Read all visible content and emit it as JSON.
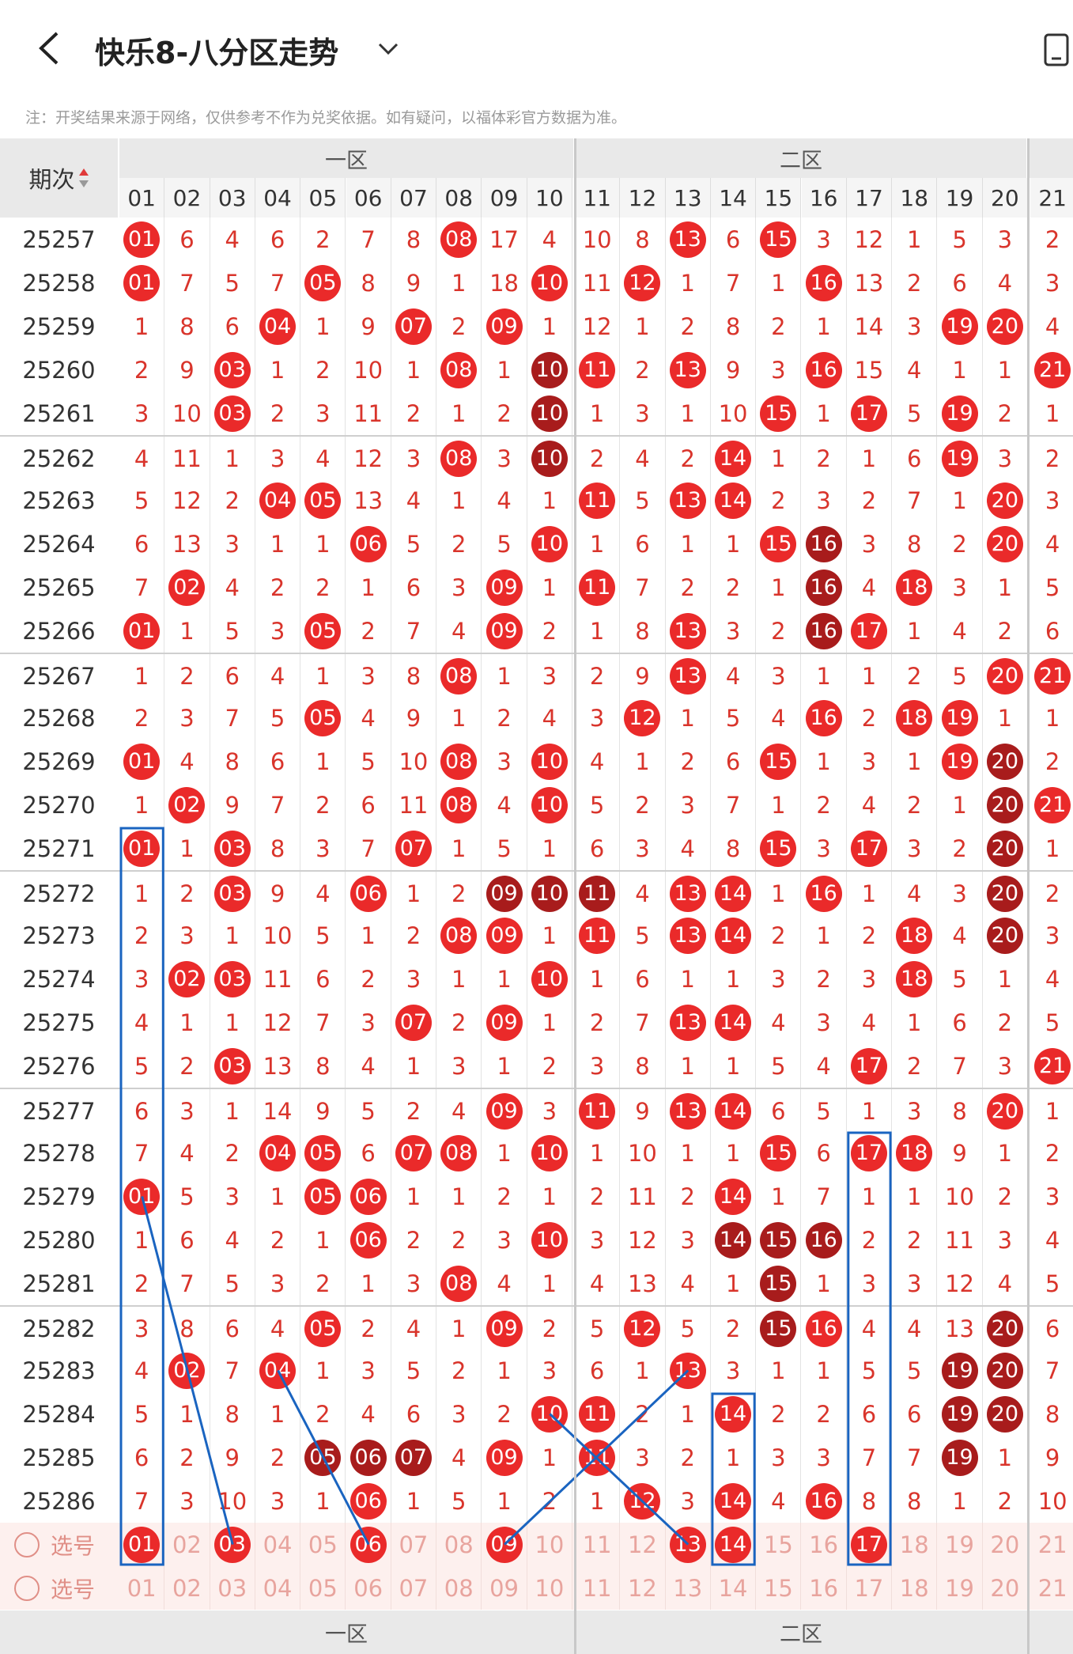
{
  "header": {
    "title": "快乐8-八分区走势",
    "note": "注：开奖结果来源于网络，仅供参考不作为兑奖依据。如有疑问，以福体彩官方数据为准。"
  },
  "table": {
    "period_header": "期次",
    "zones": [
      "一区",
      "二区"
    ],
    "columns": [
      "01",
      "02",
      "03",
      "04",
      "05",
      "06",
      "07",
      "08",
      "09",
      "10",
      "11",
      "12",
      "13",
      "14",
      "15",
      "16",
      "17",
      "18",
      "19",
      "20",
      "21"
    ],
    "rows": [
      {
        "p": "25257",
        "c": [
          "B01",
          "6",
          "4",
          "6",
          "2",
          "7",
          "8",
          "B08",
          "17",
          "4",
          "10",
          "8",
          "B13",
          "6",
          "B15",
          "3",
          "12",
          "1",
          "5",
          "3",
          "2"
        ]
      },
      {
        "p": "25258",
        "c": [
          "B01",
          "7",
          "5",
          "7",
          "B05",
          "8",
          "9",
          "1",
          "18",
          "B10",
          "11",
          "B12",
          "1",
          "7",
          "1",
          "B16",
          "13",
          "2",
          "6",
          "4",
          "3"
        ]
      },
      {
        "p": "25259",
        "c": [
          "1",
          "8",
          "6",
          "B04",
          "1",
          "9",
          "B07",
          "2",
          "B09",
          "1",
          "12",
          "1",
          "2",
          "8",
          "2",
          "1",
          "14",
          "3",
          "B19",
          "B20",
          "4"
        ]
      },
      {
        "p": "25260",
        "c": [
          "2",
          "9",
          "B03",
          "1",
          "2",
          "10",
          "1",
          "B08",
          "1",
          "D10",
          "B11",
          "2",
          "B13",
          "9",
          "3",
          "B16",
          "15",
          "4",
          "1",
          "1",
          "B21"
        ]
      },
      {
        "p": "25261",
        "c": [
          "3",
          "10",
          "B03",
          "2",
          "3",
          "11",
          "2",
          "1",
          "2",
          "D10",
          "1",
          "3",
          "1",
          "10",
          "B15",
          "1",
          "B17",
          "5",
          "B19",
          "2",
          "1"
        ]
      },
      {
        "p": "25262",
        "c": [
          "4",
          "11",
          "1",
          "3",
          "4",
          "12",
          "3",
          "B08",
          "3",
          "D10",
          "2",
          "4",
          "2",
          "B14",
          "1",
          "2",
          "1",
          "6",
          "B19",
          "3",
          "2"
        ]
      },
      {
        "p": "25263",
        "c": [
          "5",
          "12",
          "2",
          "B04",
          "B05",
          "13",
          "4",
          "1",
          "4",
          "1",
          "B11",
          "5",
          "B13",
          "B14",
          "2",
          "3",
          "2",
          "7",
          "1",
          "B20",
          "3"
        ]
      },
      {
        "p": "25264",
        "c": [
          "6",
          "13",
          "3",
          "1",
          "1",
          "B06",
          "5",
          "2",
          "5",
          "B10",
          "1",
          "6",
          "1",
          "1",
          "B15",
          "D16",
          "3",
          "8",
          "2",
          "B20",
          "4"
        ]
      },
      {
        "p": "25265",
        "c": [
          "7",
          "B02",
          "4",
          "2",
          "2",
          "1",
          "6",
          "3",
          "B09",
          "1",
          "B11",
          "7",
          "2",
          "2",
          "1",
          "D16",
          "4",
          "B18",
          "3",
          "1",
          "5"
        ]
      },
      {
        "p": "25266",
        "c": [
          "B01",
          "1",
          "5",
          "3",
          "B05",
          "2",
          "7",
          "4",
          "B09",
          "2",
          "1",
          "8",
          "B13",
          "3",
          "2",
          "D16",
          "B17",
          "1",
          "4",
          "2",
          "6"
        ]
      },
      {
        "p": "25267",
        "c": [
          "1",
          "2",
          "6",
          "4",
          "1",
          "3",
          "8",
          "B08",
          "1",
          "3",
          "2",
          "9",
          "B13",
          "4",
          "3",
          "1",
          "1",
          "2",
          "5",
          "B20",
          "B21"
        ]
      },
      {
        "p": "25268",
        "c": [
          "2",
          "3",
          "7",
          "5",
          "B05",
          "4",
          "9",
          "1",
          "2",
          "4",
          "3",
          "B12",
          "1",
          "5",
          "4",
          "B16",
          "2",
          "B18",
          "B19",
          "1",
          "1"
        ]
      },
      {
        "p": "25269",
        "c": [
          "B01",
          "4",
          "8",
          "6",
          "1",
          "5",
          "10",
          "B08",
          "3",
          "B10",
          "4",
          "1",
          "2",
          "6",
          "B15",
          "1",
          "3",
          "1",
          "B19",
          "D20",
          "2"
        ]
      },
      {
        "p": "25270",
        "c": [
          "1",
          "B02",
          "9",
          "7",
          "2",
          "6",
          "11",
          "B08",
          "4",
          "B10",
          "5",
          "2",
          "3",
          "7",
          "1",
          "2",
          "4",
          "2",
          "1",
          "D20",
          "B21"
        ]
      },
      {
        "p": "25271",
        "c": [
          "B01",
          "1",
          "B03",
          "8",
          "3",
          "7",
          "B07",
          "1",
          "5",
          "1",
          "6",
          "3",
          "4",
          "8",
          "B15",
          "3",
          "B17",
          "3",
          "2",
          "D20",
          "1"
        ]
      },
      {
        "p": "25272",
        "c": [
          "1",
          "2",
          "B03",
          "9",
          "4",
          "B06",
          "1",
          "2",
          "D09",
          "D10",
          "D11",
          "4",
          "B13",
          "B14",
          "1",
          "B16",
          "1",
          "4",
          "3",
          "D20",
          "2"
        ]
      },
      {
        "p": "25273",
        "c": [
          "2",
          "3",
          "1",
          "10",
          "5",
          "1",
          "2",
          "B08",
          "B09",
          "1",
          "B11",
          "5",
          "B13",
          "B14",
          "2",
          "1",
          "2",
          "B18",
          "4",
          "D20",
          "3"
        ]
      },
      {
        "p": "25274",
        "c": [
          "3",
          "B02",
          "B03",
          "11",
          "6",
          "2",
          "3",
          "1",
          "1",
          "B10",
          "1",
          "6",
          "1",
          "1",
          "3",
          "2",
          "3",
          "B18",
          "5",
          "1",
          "4"
        ]
      },
      {
        "p": "25275",
        "c": [
          "4",
          "1",
          "1",
          "12",
          "7",
          "3",
          "B07",
          "2",
          "B09",
          "1",
          "2",
          "7",
          "B13",
          "B14",
          "4",
          "3",
          "4",
          "1",
          "6",
          "2",
          "5"
        ]
      },
      {
        "p": "25276",
        "c": [
          "5",
          "2",
          "B03",
          "13",
          "8",
          "4",
          "1",
          "3",
          "1",
          "2",
          "3",
          "8",
          "1",
          "1",
          "5",
          "4",
          "B17",
          "2",
          "7",
          "3",
          "B21"
        ]
      },
      {
        "p": "25277",
        "c": [
          "6",
          "3",
          "1",
          "14",
          "9",
          "5",
          "2",
          "4",
          "B09",
          "3",
          "B11",
          "9",
          "B13",
          "B14",
          "6",
          "5",
          "1",
          "3",
          "8",
          "B20",
          "1"
        ]
      },
      {
        "p": "25278",
        "c": [
          "7",
          "4",
          "2",
          "B04",
          "B05",
          "6",
          "B07",
          "B08",
          "1",
          "B10",
          "1",
          "10",
          "1",
          "1",
          "B15",
          "6",
          "B17",
          "B18",
          "9",
          "1",
          "2"
        ]
      },
      {
        "p": "25279",
        "c": [
          "B01",
          "5",
          "3",
          "1",
          "B05",
          "B06",
          "1",
          "1",
          "2",
          "1",
          "2",
          "11",
          "2",
          "B14",
          "1",
          "7",
          "1",
          "1",
          "10",
          "2",
          "3"
        ]
      },
      {
        "p": "25280",
        "c": [
          "1",
          "6",
          "4",
          "2",
          "1",
          "B06",
          "2",
          "2",
          "3",
          "B10",
          "3",
          "12",
          "3",
          "D14",
          "D15",
          "D16",
          "2",
          "2",
          "11",
          "3",
          "4"
        ]
      },
      {
        "p": "25281",
        "c": [
          "2",
          "7",
          "5",
          "3",
          "2",
          "1",
          "3",
          "B08",
          "4",
          "1",
          "4",
          "13",
          "4",
          "1",
          "D15",
          "1",
          "3",
          "3",
          "12",
          "4",
          "5"
        ]
      },
      {
        "p": "25282",
        "c": [
          "3",
          "8",
          "6",
          "4",
          "B05",
          "2",
          "4",
          "1",
          "B09",
          "2",
          "5",
          "B12",
          "5",
          "2",
          "D15",
          "B16",
          "4",
          "4",
          "13",
          "D20",
          "6"
        ]
      },
      {
        "p": "25283",
        "c": [
          "4",
          "B02",
          "7",
          "B04",
          "1",
          "3",
          "5",
          "2",
          "1",
          "3",
          "6",
          "1",
          "B13",
          "3",
          "1",
          "1",
          "5",
          "5",
          "D19",
          "D20",
          "7"
        ]
      },
      {
        "p": "25284",
        "c": [
          "5",
          "1",
          "8",
          "1",
          "2",
          "4",
          "6",
          "3",
          "2",
          "B10",
          "B11",
          "2",
          "1",
          "B14",
          "2",
          "2",
          "6",
          "6",
          "D19",
          "D20",
          "8"
        ]
      },
      {
        "p": "25285",
        "c": [
          "6",
          "2",
          "9",
          "2",
          "D05",
          "D06",
          "D07",
          "4",
          "B09",
          "1",
          "B11",
          "3",
          "2",
          "1",
          "3",
          "3",
          "7",
          "7",
          "D19",
          "1",
          "9"
        ]
      },
      {
        "p": "25286",
        "c": [
          "7",
          "3",
          "10",
          "3",
          "1",
          "B06",
          "1",
          "5",
          "1",
          "2",
          "1",
          "B12",
          "3",
          "B14",
          "4",
          "B16",
          "8",
          "8",
          "1",
          "2",
          "10"
        ]
      }
    ],
    "select_rows": [
      {
        "label": "选号",
        "c": [
          "B01",
          "02",
          "B03",
          "04",
          "05",
          "B06",
          "07",
          "08",
          "B09",
          "10",
          "11",
          "12",
          "B13",
          "B14",
          "15",
          "16",
          "B17",
          "18",
          "19",
          "20",
          "21"
        ]
      },
      {
        "label": "选号",
        "c": [
          "01",
          "02",
          "03",
          "04",
          "05",
          "06",
          "07",
          "08",
          "09",
          "10",
          "11",
          "12",
          "13",
          "14",
          "15",
          "16",
          "17",
          "18",
          "19",
          "20",
          "21"
        ]
      }
    ]
  },
  "colors": {
    "ball": "#ea2a2a",
    "ball_dark": "#a81c1c",
    "miss_text": "#d9342b",
    "annotation": "#1a64c0"
  }
}
